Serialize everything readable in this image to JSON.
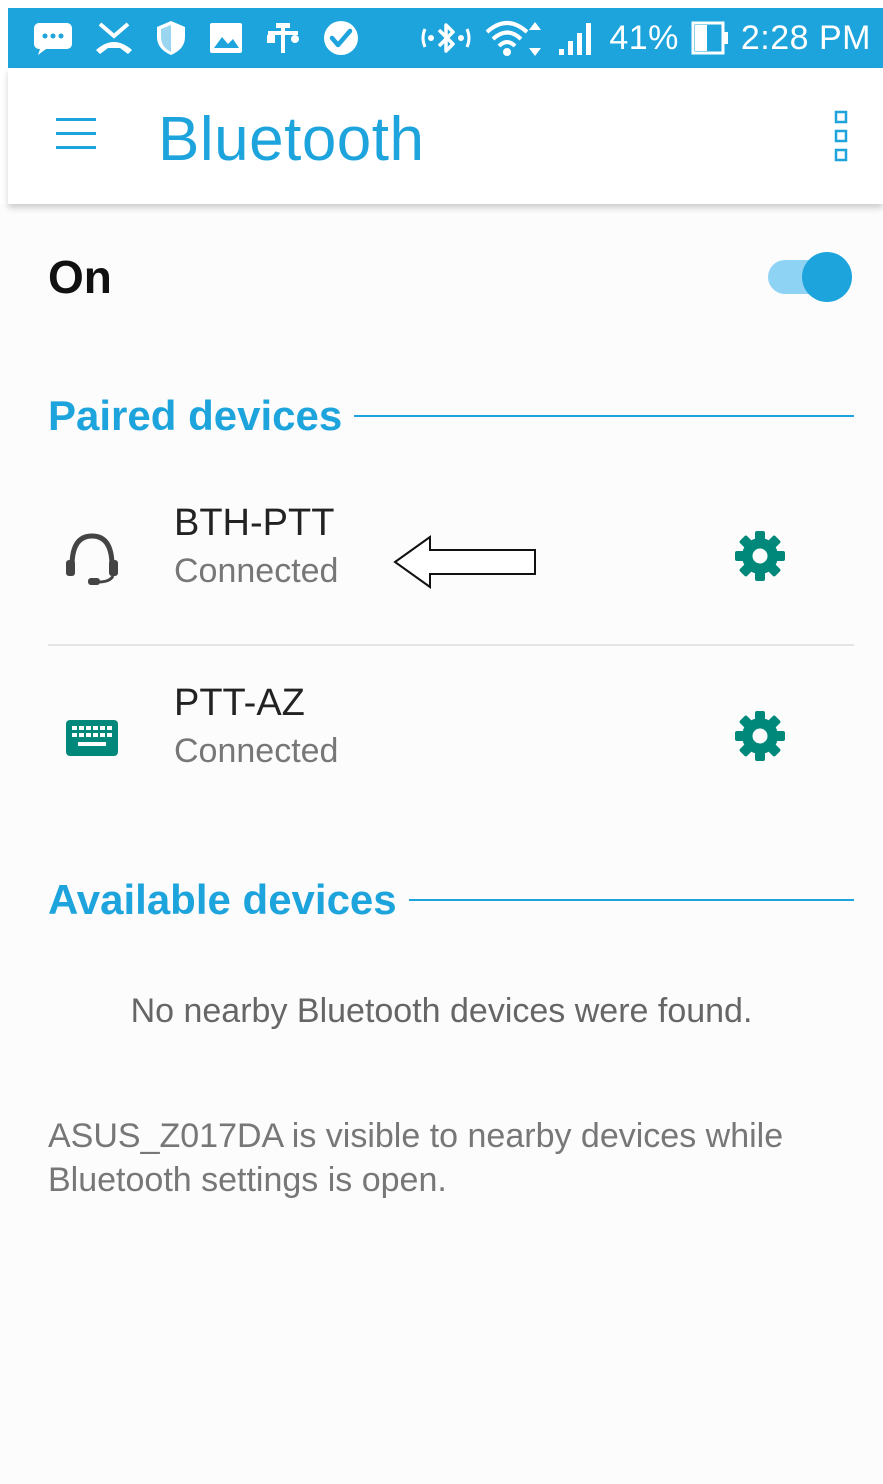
{
  "status_bar": {
    "battery_percent": "41%",
    "time": "2:28 PM",
    "icons": [
      "message-icon",
      "missed-call-icon",
      "shield-icon",
      "image-icon",
      "usb-icon",
      "check-circle-icon",
      "bluetooth-connected-icon",
      "wifi-icon",
      "signal-icon",
      "battery-icon"
    ]
  },
  "app_bar": {
    "title": "Bluetooth"
  },
  "bluetooth": {
    "state_label": "On",
    "enabled": true
  },
  "paired": {
    "header": "Paired devices",
    "devices": [
      {
        "name": "BTH-PTT",
        "status": "Connected",
        "icon": "headset-icon"
      },
      {
        "name": "PTT-AZ",
        "status": "Connected",
        "icon": "keyboard-icon"
      }
    ]
  },
  "available": {
    "header": "Available devices",
    "empty_message": "No nearby Bluetooth devices were found."
  },
  "footer": {
    "visibility_note": "ASUS_Z017DA is visible to nearby devices while Bluetooth settings is open."
  },
  "colors": {
    "accent": "#1ea4dc",
    "settings_teal": "#00897b"
  }
}
